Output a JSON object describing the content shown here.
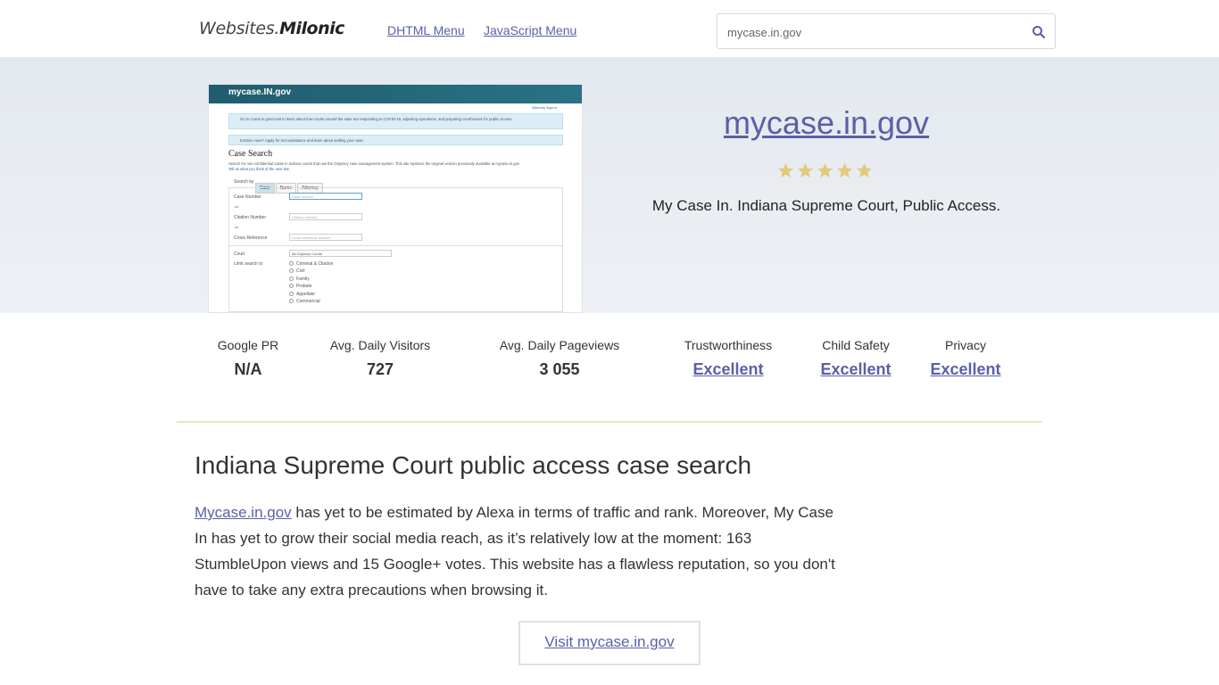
{
  "header": {
    "logo_thin": "Websites.",
    "logo_bold": "Milonic",
    "nav": [
      {
        "label": "DHTML Menu"
      },
      {
        "label": "JavaScript Menu"
      }
    ],
    "search": {
      "value": "mycase.in.gov"
    }
  },
  "hero": {
    "title": "mycase.in.gov",
    "rating": 5,
    "description": "My Case In. Indiana Supreme Court, Public Access."
  },
  "screenshot": {
    "site_name": "mycase.IN.gov",
    "attorney_link": "Attorney Sign In",
    "notice1": "Go to courts.in.gov/covid to learn about how courts around the state are responding to COVID-19, adjusting operations, and preparing courthouses for public access.",
    "notice2": "Eviction case? Apply for rent assistance and learn about settling your case",
    "title": "Case Search",
    "intro": "Search for non-confidential cases in Indiana courts that use the Odyssey case management system. This site replaces the original version previously available at mycase.in.gov",
    "intro2": "Tell us what you think of the new site.",
    "search_by": "Search by",
    "tabs": [
      "Case",
      "Name",
      "Attorney"
    ],
    "fields": [
      {
        "label": "Case Number",
        "placeholder": "Case number"
      },
      {
        "label": "Citation Number",
        "placeholder": "Citation number"
      },
      {
        "label": "Cross Reference",
        "placeholder": "Cross reference number"
      }
    ],
    "or": "-or-",
    "court_label": "Court",
    "court_value": "All Odyssey Courts",
    "limit_label": "Limit search to",
    "limits": [
      "Criminal & Citation",
      "Civil",
      "Family",
      "Probate",
      "Appellate",
      "Commercial"
    ]
  },
  "stats": [
    {
      "label": "Google PR",
      "value": "N/A",
      "link": false
    },
    {
      "label": "Avg. Daily Visitors",
      "value": "727",
      "link": false
    },
    {
      "label": "Avg. Daily Pageviews",
      "value": "3 055",
      "link": false
    },
    {
      "label": "Trustworthiness",
      "value": "Excellent",
      "link": true
    },
    {
      "label": "Child Safety",
      "value": "Excellent",
      "link": true
    },
    {
      "label": "Privacy",
      "value": "Excellent",
      "link": true
    }
  ],
  "article": {
    "heading": "Indiana Supreme Court public access case search",
    "link_text": "Mycase.in.gov",
    "body": " has yet to be estimated by Alexa in terms of traffic and rank. Moreover, My Case In has yet to grow their social media reach, as it’s relatively low at the moment: 163 StumbleUpon views and 15 Google+ votes. This website has a flawless reputation, so you don't have to take any extra precautions when browsing it.",
    "visit_label": "Visit mycase.in.gov"
  },
  "colors": {
    "link": "#5b5fa8",
    "star": "#e2c97d",
    "divider": "#e8e6c4"
  }
}
